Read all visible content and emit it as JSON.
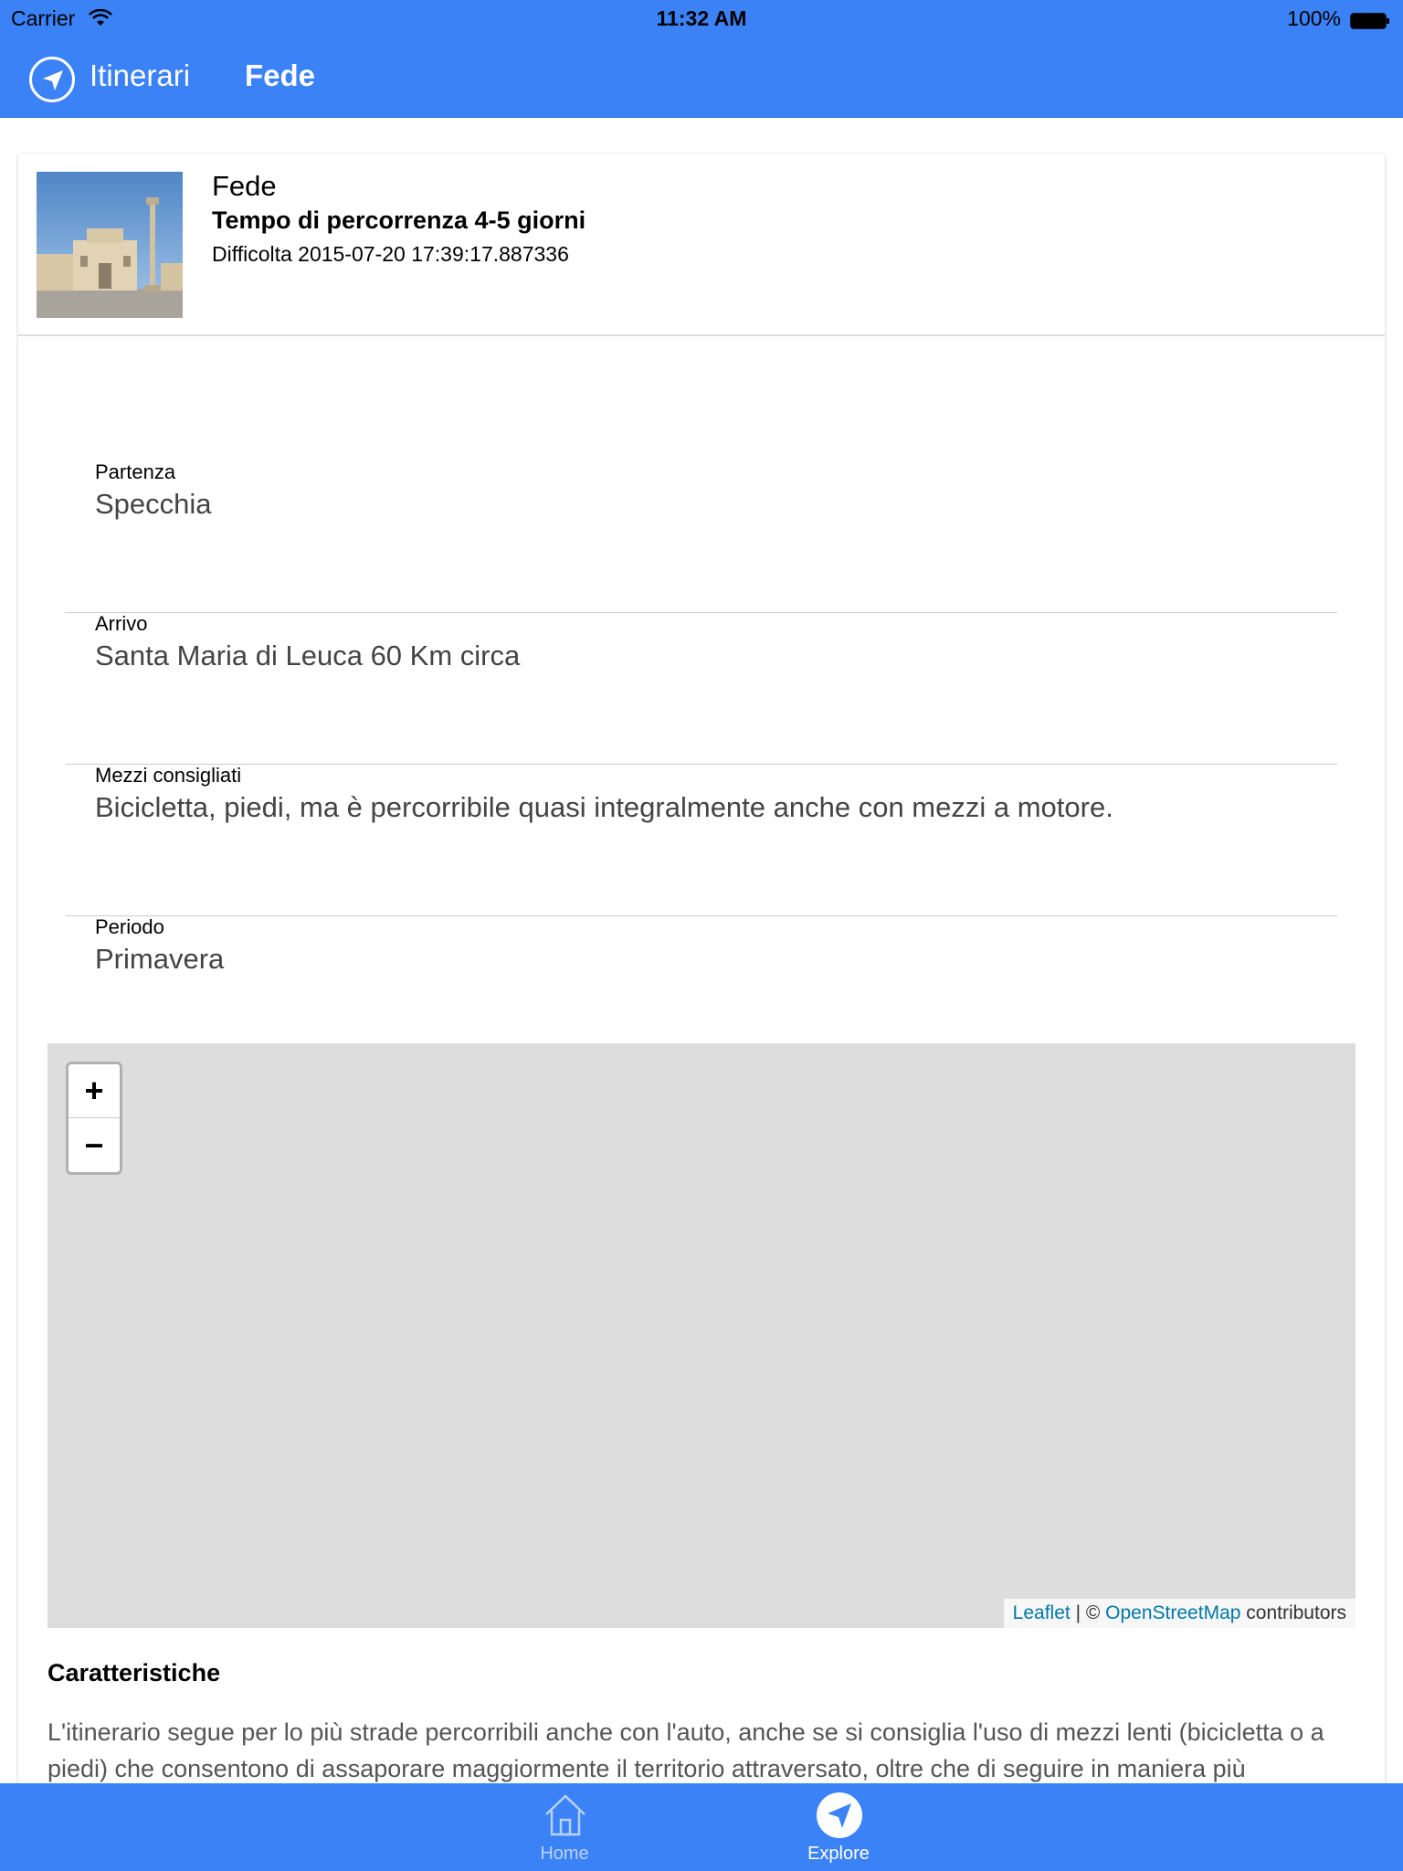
{
  "status_bar": {
    "carrier": "Carrier",
    "time": "11:32 AM",
    "battery": "100%"
  },
  "nav": {
    "icon": "navigation-arrow-icon",
    "title": "Itinerari",
    "subtitle": "Fede"
  },
  "header": {
    "title": "Fede",
    "time": "Tempo di percorrenza 4-5 giorni",
    "difficulty": "Difficolta 2015-07-20 17:39:17.887336"
  },
  "fields": [
    {
      "label": "Partenza",
      "value": "Specchia"
    },
    {
      "label": "Arrivo",
      "value": "Santa Maria di Leuca 60 Km circa"
    },
    {
      "label": "Mezzi consigliati",
      "value": "Bicicletta, piedi, ma è percorribile quasi integralmente anche con mezzi a motore."
    },
    {
      "label": "Periodo",
      "value": "Primavera"
    }
  ],
  "map": {
    "zoom_in": "+",
    "zoom_out": "−",
    "attribution_leaflet": "Leaflet",
    "attribution_sep": " | © ",
    "attribution_osm": "OpenStreetMap",
    "attribution_suffix": " contributors"
  },
  "section": {
    "title": "Caratteristiche",
    "text": "L'itinerario segue per lo più strade percorribili anche con l'auto, anche se si consiglia l'uso di mezzi lenti (bicicletta o a piedi) che consentono di assaporare maggiormente il territorio attraversato, oltre che di seguire in maniera più"
  },
  "tabbar": {
    "home": "Home",
    "explore": "Explore"
  },
  "colors": {
    "primary": "#3b82f6",
    "map_bg": "#dddddd",
    "link": "#0078a8"
  }
}
